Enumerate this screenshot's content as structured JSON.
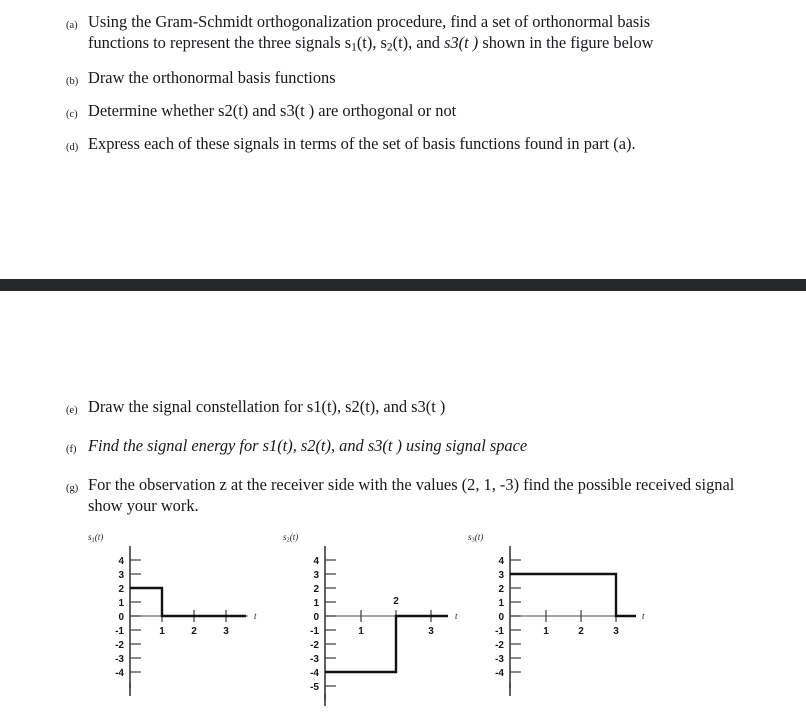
{
  "document": {
    "type": "homework-problem-sheet",
    "background_color": "#ffffff",
    "text_color": "#17181c",
    "divider_band_color": "#26272b"
  },
  "questions_top": [
    {
      "label": "(a)",
      "line1_pre": "Using the Gram-Schmidt orthogonalization procedure, find a set of orthonormal basis",
      "line2_pre": "functions to represent the three signals s",
      "sub1": "1",
      "mid1": "(t), s",
      "sub2": "2",
      "mid2": "(t), and ",
      "italic": "s3(t )",
      "post": " shown in  the figure below",
      "plain": "Using the Gram-Schmidt orthogonalization procedure, find a set of orthonormal basis functions to represent the three signals s1(t), s2(t), and s3(t ) shown in  the figure below"
    },
    {
      "label": "(b)",
      "plain": "Draw the orthonormal basis functions"
    },
    {
      "label": "(c)",
      "plain": "Determine whether s2(t) and s3(t ) are orthogonal or not"
    },
    {
      "label": "(d)",
      "plain": "Express each of these signals in terms of the set of basis functions found in part (a)."
    }
  ],
  "questions_bottom": [
    {
      "label": "(e)",
      "plain": "Draw the signal constellation for s1(t), s2(t), and s3(t )"
    },
    {
      "label": "(f)",
      "plain": "Find the signal energy for s1(t), s2(t), and s3(t ) using signal space"
    },
    {
      "label": "(g)",
      "plain": "For the observation z at the receiver side with the values (2, 1, -3) find the possible received signal show your work.",
      "observation_values": "(2, 1, -3)",
      "observation_symbol": "z"
    }
  ],
  "chart_data": [
    {
      "type": "line",
      "name": "s1",
      "title": "s1(t)",
      "title_base": "s",
      "title_sub": "1",
      "title_tail": "(t)",
      "xlabel": "t",
      "ylabel": "",
      "x": [
        0,
        1,
        1,
        3.6
      ],
      "values": [
        2,
        2,
        0,
        0
      ],
      "description": "Rectangular pulse of amplitude 2 for 0 <= t < 1, zero afterwards",
      "amplitude": 2,
      "duration": 1,
      "xlim": [
        0,
        3.6
      ],
      "ylim": [
        -4,
        4
      ],
      "xticks": [
        1,
        2,
        3
      ],
      "xtick_labels": [
        "1",
        "2",
        "3"
      ],
      "xtick_label_side": [
        "below",
        "below",
        "below"
      ],
      "yticks": [
        4,
        3,
        2,
        1,
        0,
        -1,
        -2,
        -3,
        -4
      ],
      "ytick_labels": [
        "4",
        "3",
        "2",
        "1",
        "0",
        "-1",
        "-2",
        "-3",
        "-4"
      ],
      "grid": false
    },
    {
      "type": "line",
      "name": "s2",
      "title": "s2(t)",
      "title_base": "s",
      "title_sub": "2",
      "title_tail": "(t)",
      "xlabel": "t",
      "ylabel": "",
      "x": [
        0,
        2,
        2,
        3.6
      ],
      "values": [
        -4,
        -4,
        0,
        0
      ],
      "description": "Rectangular pulse of amplitude -4 for 0 <= t < 2, zero afterwards",
      "amplitude": -4,
      "duration": 2,
      "xlim": [
        0,
        3.6
      ],
      "ylim": [
        -5,
        4
      ],
      "xticks": [
        1,
        2,
        3
      ],
      "xtick_labels": [
        "1",
        "2",
        "3"
      ],
      "xtick_label_side": [
        "below",
        "above",
        "below"
      ],
      "yticks": [
        4,
        3,
        2,
        1,
        0,
        -1,
        -2,
        -3,
        -4,
        -5
      ],
      "ytick_labels": [
        "4",
        "3",
        "2",
        "1",
        "0",
        "-1",
        "-2",
        "-3",
        "-4",
        "-5"
      ],
      "grid": false
    },
    {
      "type": "line",
      "name": "s3",
      "title": "s3(t)",
      "title_base": "s",
      "title_sub": "3",
      "title_tail": "(t)",
      "xlabel": "t",
      "ylabel": "",
      "x": [
        0,
        3,
        3,
        3.6
      ],
      "values": [
        3,
        3,
        0,
        0
      ],
      "description": "Rectangular pulse of amplitude 3 for 0 <= t < 3, zero afterwards",
      "amplitude": 3,
      "duration": 3,
      "xlim": [
        0,
        3.6
      ],
      "ylim": [
        -4,
        4
      ],
      "xticks": [
        1,
        2,
        3
      ],
      "xtick_labels": [
        "1",
        "2",
        "3"
      ],
      "xtick_label_side": [
        "below",
        "below",
        "below"
      ],
      "yticks": [
        4,
        3,
        2,
        1,
        0,
        -1,
        -2,
        -3,
        -4
      ],
      "ytick_labels": [
        "4",
        "3",
        "2",
        "1",
        "0",
        "-1",
        "-2",
        "-3",
        "-4"
      ],
      "grid": false
    }
  ]
}
